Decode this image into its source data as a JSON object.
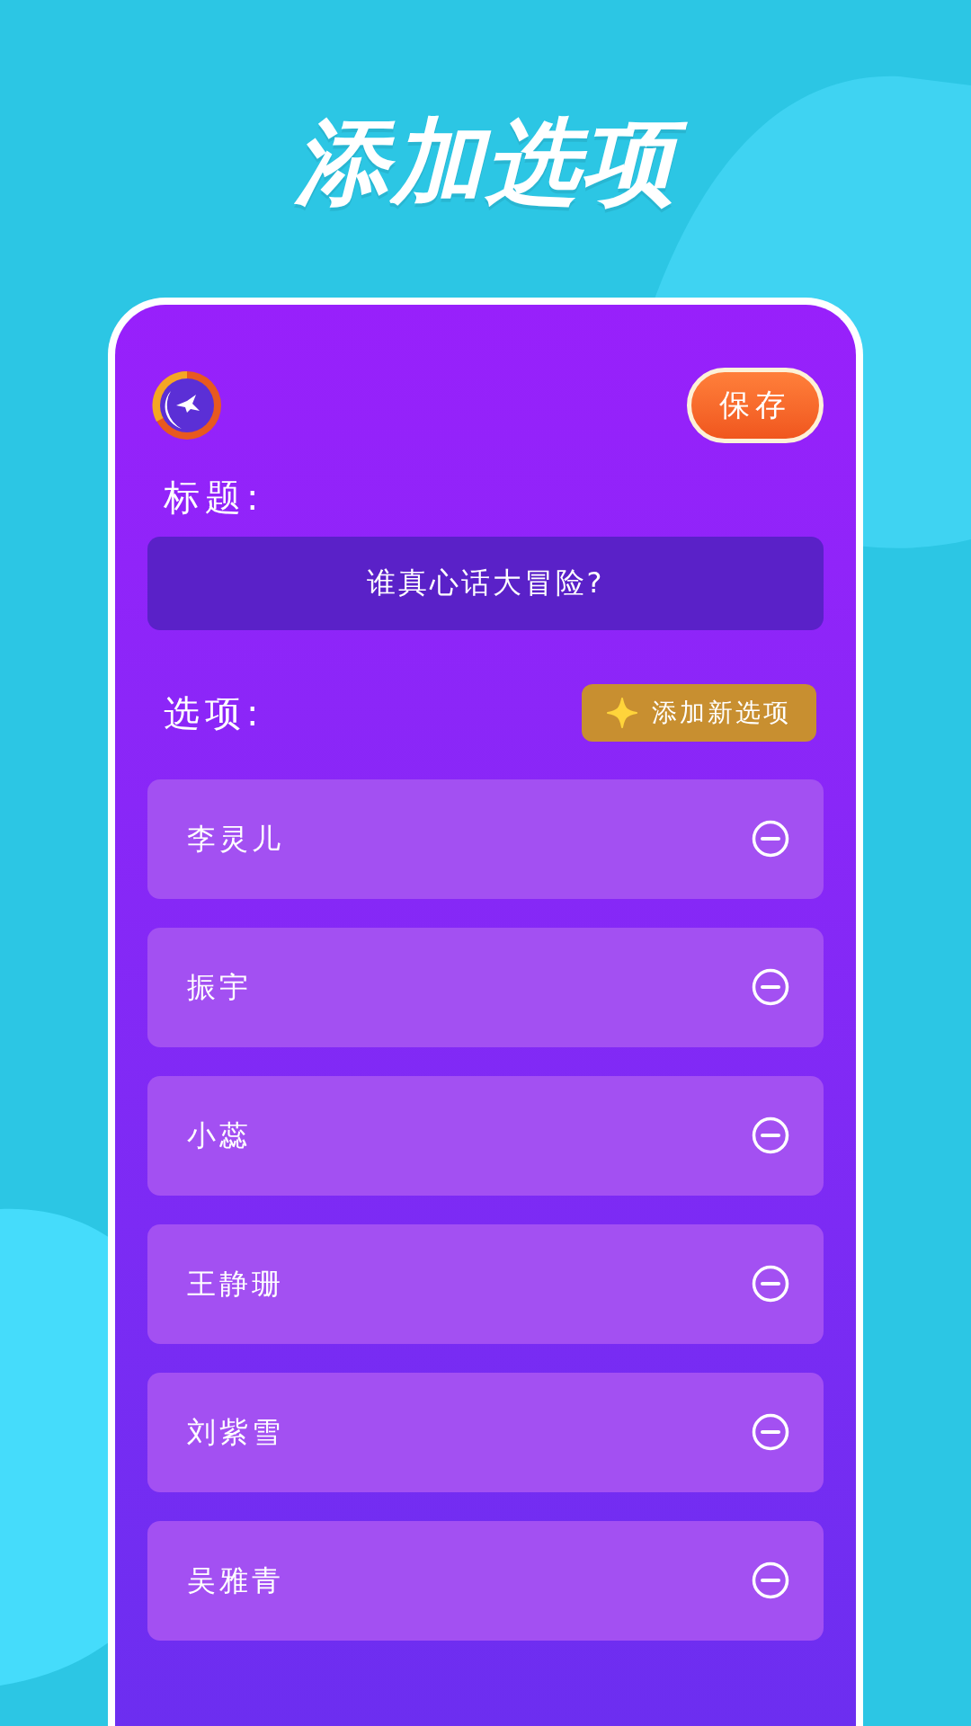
{
  "page_title": "添加选项",
  "save_button": "保存",
  "title_label": "标题:",
  "title_field": {
    "value": "谁真心话大冒险?"
  },
  "options_label": "选项:",
  "add_button": "添加新选项",
  "options": [
    {
      "label": "李灵儿"
    },
    {
      "label": "振宇"
    },
    {
      "label": "小蕊"
    },
    {
      "label": "王静珊"
    },
    {
      "label": "刘紫雪"
    },
    {
      "label": "吴雅青"
    }
  ]
}
